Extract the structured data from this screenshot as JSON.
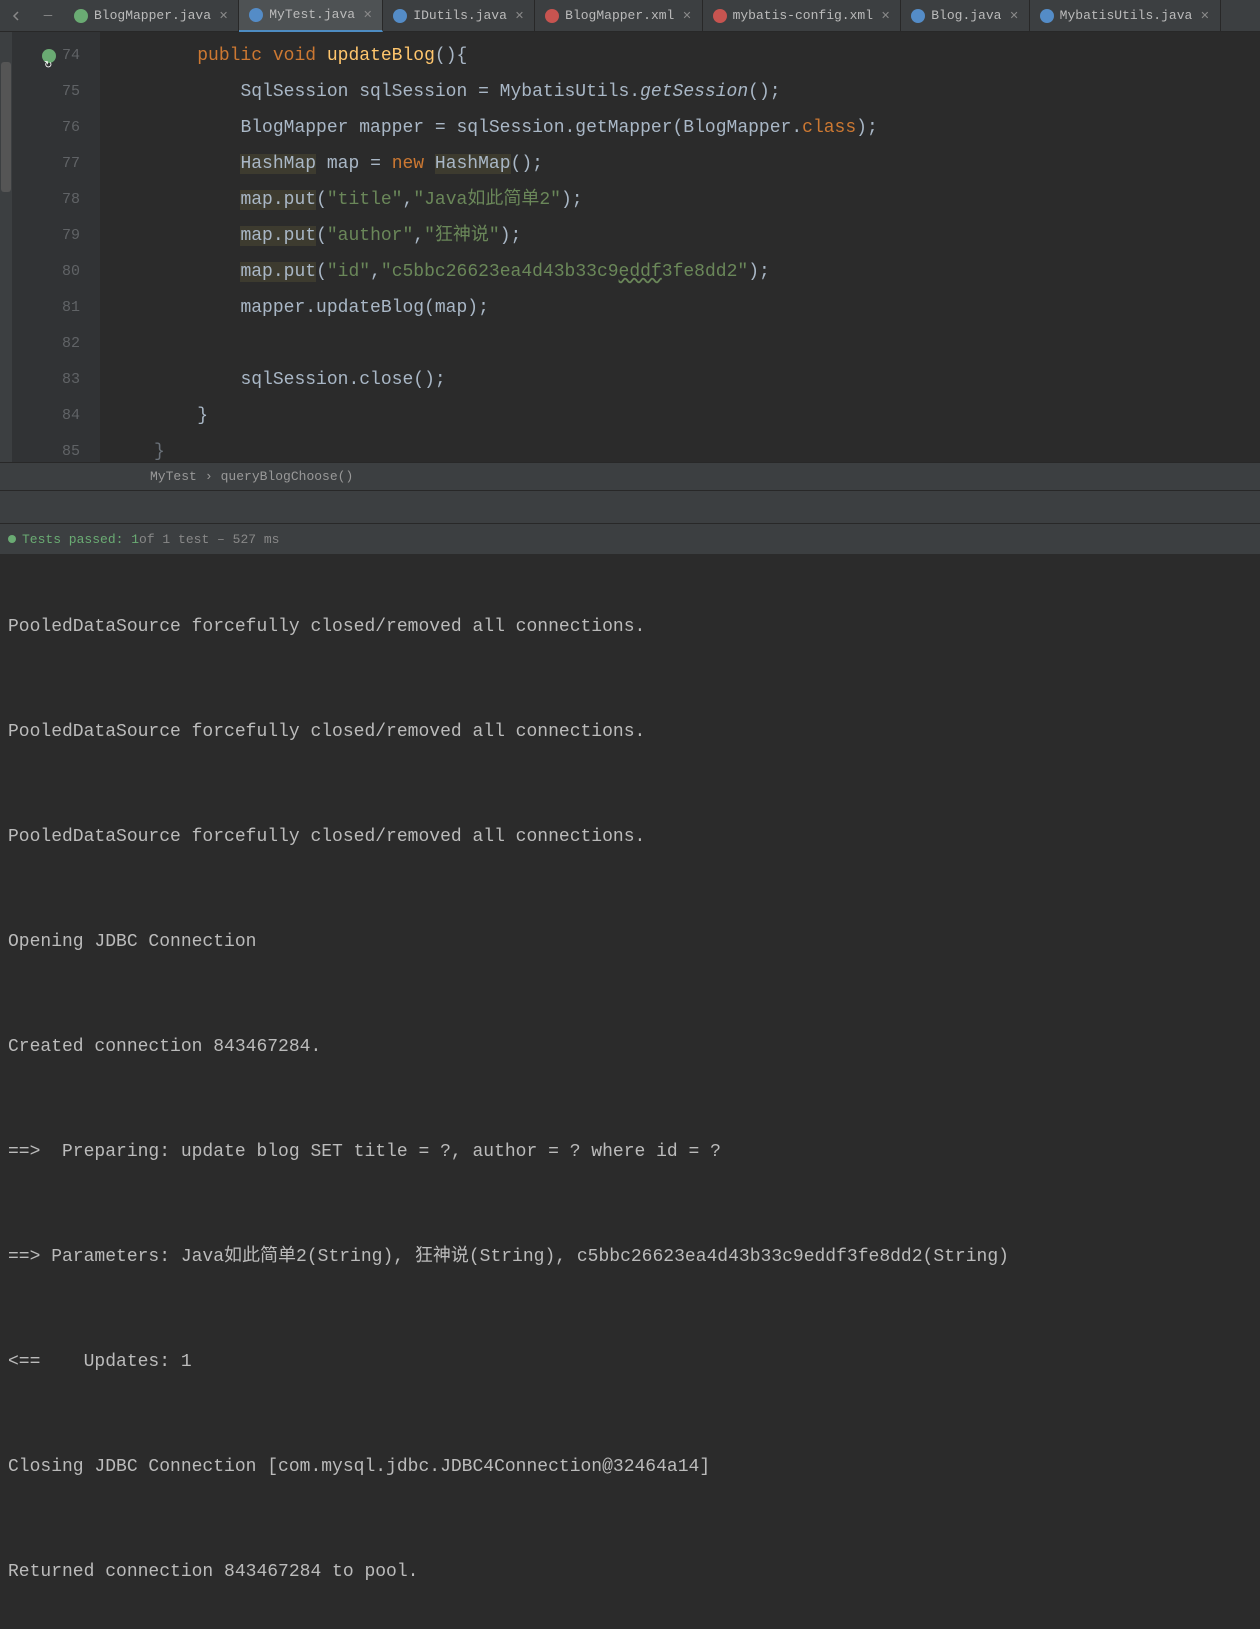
{
  "tabs": [
    {
      "label": "BlogMapper.java",
      "icon": "java",
      "active": false
    },
    {
      "label": "MyTest.java",
      "icon": "class",
      "active": true
    },
    {
      "label": "IDutils.java",
      "icon": "class",
      "active": false
    },
    {
      "label": "BlogMapper.xml",
      "icon": "xml",
      "active": false
    },
    {
      "label": "mybatis-config.xml",
      "icon": "xml",
      "active": false
    },
    {
      "label": "Blog.java",
      "icon": "class",
      "active": false
    },
    {
      "label": "MybatisUtils.java",
      "icon": "class",
      "active": false
    }
  ],
  "lineNumbers": [
    "74",
    "75",
    "76",
    "77",
    "78",
    "79",
    "80",
    "81",
    "82",
    "83",
    "84",
    "85"
  ],
  "code": {
    "l74": {
      "indent": "         ",
      "kw1": "public",
      "kw2": "void",
      "method": "updateBlog",
      "tail": "(){"
    },
    "l75": {
      "indent": "             ",
      "t1": "SqlSession sqlSession = MybatisUtils.",
      "call": "getSession",
      "t2": "();"
    },
    "l76": {
      "indent": "             ",
      "t": "BlogMapper mapper = sqlSession.getMapper(BlogMapper.",
      "kw": "class",
      "t2": ");"
    },
    "l77": {
      "indent": "             ",
      "h1": "HashMap",
      "t1": " map = ",
      "kw": "new",
      "t2": " ",
      "h2": "HashMap",
      "t3": "();"
    },
    "l78": {
      "indent": "             ",
      "h": "map.put",
      "t1": "(",
      "s1": "\"title\"",
      "t2": ",",
      "s2": "\"Java如此简单2\"",
      "t3": ");"
    },
    "l79": {
      "indent": "             ",
      "h": "map.put",
      "t1": "(",
      "s1": "\"author\"",
      "t2": ",",
      "s2": "\"狂神说\"",
      "t3": ");"
    },
    "l80": {
      "indent": "             ",
      "h": "map.put",
      "t1": "(",
      "s1": "\"id\"",
      "t2": ",",
      "s2a": "\"c5bbc26623ea4d43b33c9",
      "s2b": "eddf",
      "s2c": "3fe8dd2\"",
      "t3": ");"
    },
    "l81": {
      "indent": "             ",
      "t": "mapper.updateBlog(map);"
    },
    "l82": {
      "indent": ""
    },
    "l83": {
      "indent": "             ",
      "t": "sqlSession.close();"
    },
    "l84": {
      "indent": "         ",
      "t": "}"
    },
    "l85": {
      "indent": "     ",
      "t": "}"
    }
  },
  "breadcrumb": {
    "class": "MyTest",
    "sep": "›",
    "method": "queryBlogChoose()"
  },
  "testStatus": {
    "passed": "Tests passed: 1",
    "rest": " of 1 test – 527 ms"
  },
  "console": [
    "PooledDataSource forcefully closed/removed all connections.",
    "PooledDataSource forcefully closed/removed all connections.",
    "PooledDataSource forcefully closed/removed all connections.",
    "Opening JDBC Connection",
    "Created connection 843467284.",
    "==>  Preparing: update blog SET title = ?, author = ? where id = ? ",
    "==> Parameters: Java如此简单2(String), 狂神说(String), c5bbc26623ea4d43b33c9eddf3fe8dd2(String)",
    "<==    Updates: 1",
    "Closing JDBC Connection [com.mysql.jdbc.JDBC4Connection@32464a14]",
    "Returned connection 843467284 to pool."
  ]
}
